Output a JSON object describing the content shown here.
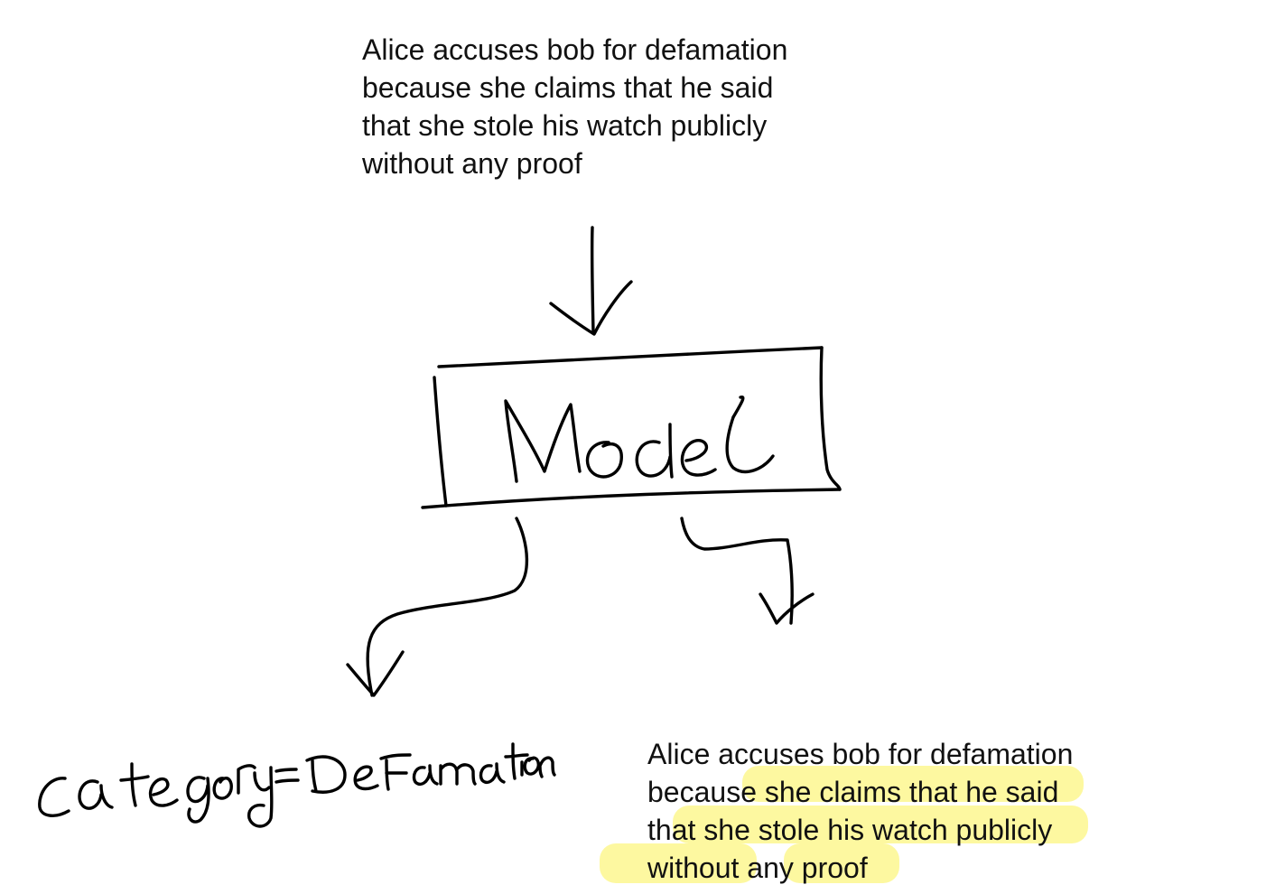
{
  "input_text": {
    "lines": [
      "Alice accuses bob for defamation",
      "because she claims that he said",
      "that she stole his watch publicly",
      "without any proof"
    ]
  },
  "model_box": {
    "label": "Model"
  },
  "classification_output": {
    "label": "category = Defamation"
  },
  "explanation_output": {
    "lines": [
      "Alice accuses bob for defamation",
      "because she claims that he said",
      "that she stole his watch publicly",
      "without any proof"
    ],
    "highlight_color": "#fdf8a0"
  },
  "colors": {
    "ink": "#000000",
    "text": "#111111",
    "background": "#ffffff",
    "highlight": "#fdf8a0"
  }
}
